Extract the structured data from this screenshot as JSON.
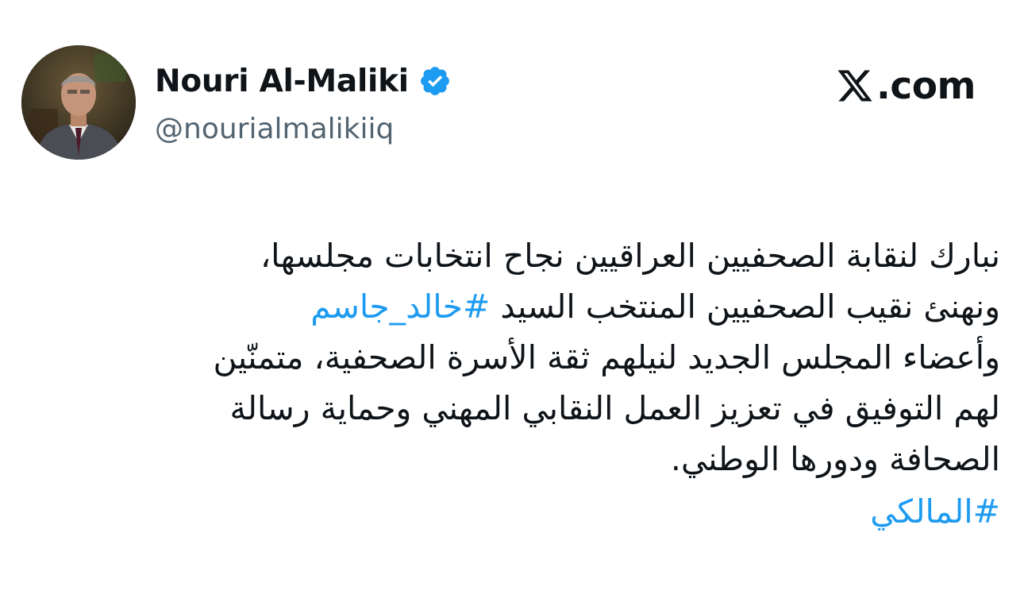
{
  "author": {
    "display_name": "Nouri Al-Maliki",
    "handle": "@nourialmalikiiq",
    "verified": true,
    "verified_color": "#1d9bf0"
  },
  "brand": {
    "logo": "x-logo-icon",
    "domain": ".com"
  },
  "tweet": {
    "line1": "نبارك لنقابة الصحفيين العراقيين نجاح انتخابات مجلسها،",
    "line2_text": "ونهنئ نقيب الصحفيين المنتخب السيد ",
    "line2_hashtag": "#خالد_جاسم",
    "line3": "وأعضاء المجلس الجديد لنيلهم ثقة الأسرة الصحفية، متمنّين",
    "line4": "لهم التوفيق في تعزيز العمل النقابي المهني وحماية رسالة",
    "line5": "الصحافة ودورها الوطني.",
    "hashtag_final": "#المالكي",
    "hashtag_color": "#1d9bf0"
  }
}
